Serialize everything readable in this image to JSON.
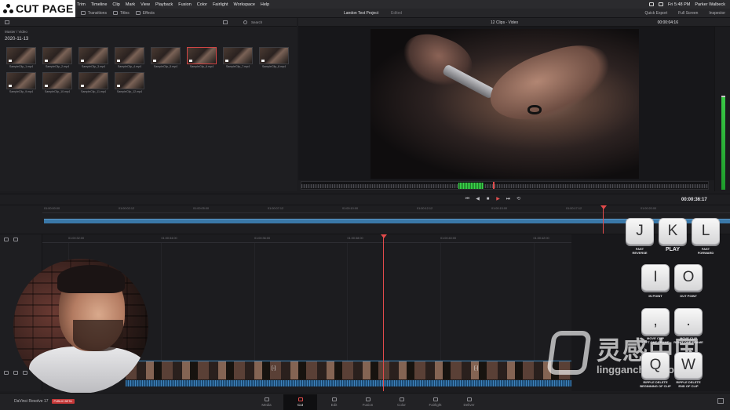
{
  "overlay_title": "CUT PAGE",
  "menubar": {
    "items": [
      "Trim",
      "Timeline",
      "Clip",
      "Mark",
      "View",
      "Playback",
      "Fusion",
      "Color",
      "Fairlight",
      "Workspace",
      "Help"
    ],
    "clock": "Fri 5:48 PM",
    "user": "Parker Walbeck"
  },
  "toolbar": {
    "media_tab": "dia",
    "transitions": "Transitions",
    "titles": "Titles",
    "effects": "Effects",
    "project_title": "Landon Test Project",
    "edited": "Edited",
    "quick_export": "Quick Export",
    "full_screen": "Full Screen",
    "inspector": "Inspector"
  },
  "pool": {
    "search": "Search",
    "breadcrumb": "Master / Video",
    "date": "2020-11-13",
    "clips": [
      "SampleClip_1.mp4",
      "SampleClip_2.mp4",
      "SampleClip_3.mp4",
      "SampleClip_4.mp4",
      "SampleClip_5.mp4",
      "SampleClip_6.mp4",
      "SampleClip_7.mp4",
      "SampleClip_8.mp4",
      "SampleClip_9.mp4",
      "SampleClip_10.mp4",
      "SampleClip_11.mp4",
      "SampleClip_12.mp4"
    ]
  },
  "viewer": {
    "title": "12 Clips - Video",
    "timecode": "00:00:04:16"
  },
  "transport": {
    "timecode": "00:00:36:17"
  },
  "upper_ruler": [
    "01:00:00:00",
    "01:00:02:12",
    "01:00:05:00",
    "01:00:07:12",
    "01:00:10:00",
    "01:00:12:12",
    "01:00:15:00",
    "01:00:17:12",
    "01:00:20:00"
  ],
  "lower_ruler": [
    "01:00:32:00",
    "01:00:34:00",
    "01:00:36:00",
    "01:00:38:00",
    "01:00:40:00",
    "01:00:42:00"
  ],
  "keys": {
    "j": {
      "letter": "J",
      "caption": "FAST\nREVERSE"
    },
    "k": {
      "letter": "K",
      "caption": "PLAY"
    },
    "l": {
      "letter": "L",
      "caption": "FAST\nFORWARD"
    },
    "i": {
      "letter": "I",
      "caption": "IN POINT"
    },
    "o": {
      "letter": "O",
      "caption": "OUT POINT"
    },
    "comma": {
      "letter": ",",
      "caption": "MOVE CLIP\nLEFT ONE FRAME"
    },
    "period": {
      "letter": ".",
      "caption": "MOVE CLIP\nRIGHT ONE FRAME"
    },
    "q": {
      "letter": "Q",
      "caption": "RIPPLE DELETE\nBEGINNING OF CLIP"
    },
    "w": {
      "letter": "W",
      "caption": "RIPPLE DELETE\nEND OF CLIP"
    }
  },
  "pagebar": {
    "brand": "DaVinci Resolve 17",
    "beta": "PUBLIC BETA",
    "tabs": [
      "Media",
      "Cut",
      "Edit",
      "Fusion",
      "Color",
      "Fairlight",
      "Deliver"
    ]
  },
  "watermark": {
    "cn": "灵感中国",
    "en": "lingganchina.com"
  },
  "colors": {
    "accent_red": "#e24b4b",
    "track_blue": "#3a78a8",
    "meter_green": "#39c845"
  }
}
